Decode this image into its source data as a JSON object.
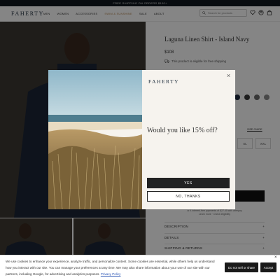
{
  "announcement": "FREE SHIPPING ON ORDERS $100+",
  "header": {
    "logo": "FAHERTY",
    "nav": [
      "MEN",
      "WOMEN",
      "ACCESSORIES",
      "SWIM & SUNSHINE",
      "SALE",
      "ABOUT"
    ],
    "search_placeholder": "Search for products"
  },
  "product": {
    "title": "Laguna Linen Shirt - Island Navy",
    "price": "$108",
    "shipping_note": "This product is eligible for free shipping",
    "size_guide": "SIZE GUIDE",
    "sizes": [
      "XL",
      "XXL"
    ],
    "afterpay_line1": "or 4 interest-free payments of $27.00 with afterpay",
    "afterpay_line2": "Learn more · Check eligibility",
    "accordions": [
      "DESCRIPTION",
      "DETAILS",
      "SHIPPING & RETURNS"
    ],
    "accordion_symbol": "+"
  },
  "modal": {
    "logo": "FAHERTY",
    "close": "×",
    "headline": "Would you like 15% off?",
    "yes_label": "YES",
    "no_label": "NO, THANKS"
  },
  "cookie": {
    "text": "We use cookies to enhance your experience, analyze traffic, and personalize content. Some cookies are essential, while others help us understand how you interact with our site. You can manage your preferences at any time. We may also share information about your use of our site with our partners, including Google, for advertising and analytics purposes.",
    "privacy_link": "Privacy Policy",
    "btn_decline": "Do not sell or share",
    "btn_accept": "Accept",
    "close": "×"
  },
  "colors": {
    "swatch1": "#1f2b3f",
    "swatch2": "#3b3b3b",
    "swatch3": "#6a6a6a",
    "swatch4": "#8a8a8a",
    "dark": "#222222"
  }
}
